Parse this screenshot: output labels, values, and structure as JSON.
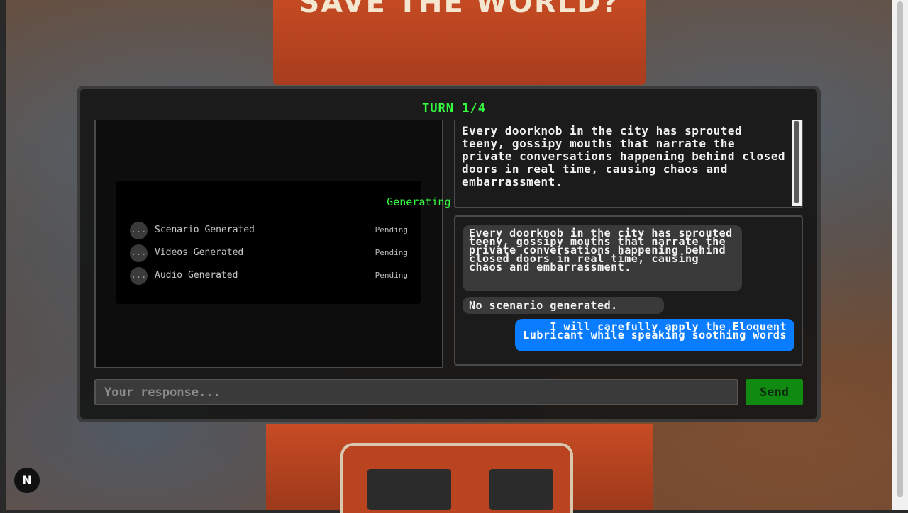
{
  "background": {
    "marquee_text": "SAVE THE WORLD?"
  },
  "game": {
    "turn_label": "TURN 1/4"
  },
  "generation": {
    "title": "Generating Content...",
    "items": [
      {
        "indicator": "...",
        "label": "Scenario Generated",
        "status": "Pending"
      },
      {
        "indicator": "...",
        "label": "Videos Generated",
        "status": "Pending"
      },
      {
        "indicator": "...",
        "label": "Audio Generated",
        "status": "Pending"
      }
    ]
  },
  "scenario": {
    "text": "Every doorknob in the city has sprouted teeny, gossipy mouths that narrate the private conversations happening behind closed doors in real time, causing chaos and embarrassment."
  },
  "chat": {
    "messages": [
      {
        "role": "system",
        "text": "Every doorknob in the city has sprouted teeny, gossipy mouths that narrate the private conversations happening behind closed doors in real time, causing chaos and embarrassment."
      },
      {
        "role": "system",
        "text": "No scenario generated."
      },
      {
        "role": "user",
        "text": "I will carefully apply the Eloquent Lubricant while speaking soothing words"
      }
    ]
  },
  "response": {
    "placeholder": "Your response...",
    "value": "",
    "send_label": "Send"
  },
  "dev_badge": {
    "label": "N",
    "icon": "nextjs-icon"
  },
  "colors": {
    "accent_green": "#35ff3e",
    "send_button": "#108a10",
    "user_bubble": "#0a7cff"
  }
}
